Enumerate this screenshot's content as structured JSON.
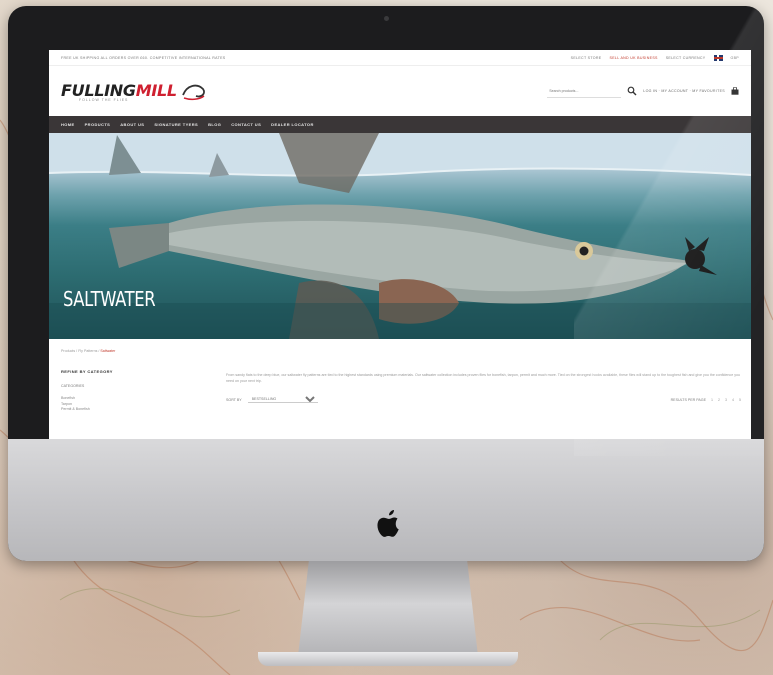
{
  "promo": {
    "left_text": "FREE UK SHIPPING ALL ORDERS OVER £60. COMPETITIVE INTERNATIONAL RATES",
    "right_items": [
      "SELECT STORE",
      "SELL AND UK BUSINESS",
      "SELECT CURRENCY",
      "GBP"
    ],
    "red_item_index": 1
  },
  "brand": {
    "name_part1": "FULLING",
    "name_part2": "MILL",
    "tagline": "FOLLOW THE FLIES"
  },
  "header": {
    "search_placeholder": "Search products...",
    "account_text": "LOG IN · MY ACCOUNT · MY FAVOURITES"
  },
  "nav": {
    "items": [
      "HOME",
      "PRODUCTS",
      "ABOUT US",
      "SIGNATURE TYERS",
      "BLOG",
      "CONTACT US",
      "DEALER LOCATOR"
    ]
  },
  "hero": {
    "title": "SALTWATER"
  },
  "breadcrumb": {
    "parts": [
      "Products",
      "Fly Patterns"
    ],
    "current": "Saltwater"
  },
  "sidebar": {
    "title": "REFINE BY CATEGORY",
    "subtitle": "CATEGORIES",
    "items": [
      "Bonefish",
      "Tarpon",
      "Permit & Bonefish"
    ]
  },
  "main": {
    "intro": "From sandy flats to the deep blue, our saltwater fly patterns are tied to the highest standards using premium materials. Our saltwater collection includes proven flies for bonefish, tarpon, permit and much more. Tied on the strongest hooks available, these flies will stand up to the toughest fish and give you the confidence you need on your next trip.",
    "sort_label": "SORT BY",
    "sort_value": "BESTSELLING",
    "pager_label": "RESULTS PER PAGE",
    "pages": [
      "1",
      "2",
      "3",
      "4",
      "5"
    ]
  },
  "colors": {
    "brand_red": "#cf2030",
    "nav_bg": "#3a3637"
  }
}
